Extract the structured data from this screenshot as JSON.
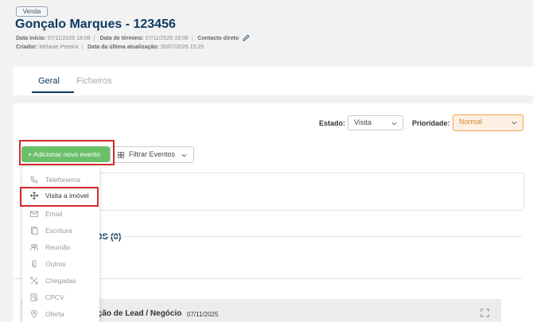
{
  "header": {
    "tag": "Venda",
    "title": "Gonçalo Marques - 123456",
    "meta_line1": [
      {
        "label": "Data início:",
        "value": "07/11/2025 18:06"
      },
      {
        "label": "Data de término:",
        "value": "07/11/2025 19:06"
      },
      {
        "label": "Contacto direto",
        "value": ""
      }
    ],
    "meta_line2": [
      {
        "label": "Criador:",
        "value": "Melanie Pereira"
      },
      {
        "label": "Data da última atualização:",
        "value": "30/07/2026 15:25"
      }
    ]
  },
  "tabs": [
    "Geral",
    "Ficheiros"
  ],
  "filters": {
    "estado_label": "Estado:",
    "estado_value": "Visita",
    "prioridade_label": "Prioridade:",
    "prioridade_value": "Normal"
  },
  "actions": {
    "add_event": "+ Adicionar novo evento",
    "filter_events": "Filtrar Eventos"
  },
  "event_menu": [
    {
      "label": "Telefonema",
      "icon": "phone-icon"
    },
    {
      "label": "Visita a imóvel",
      "icon": "move-icon"
    },
    {
      "label": "Email",
      "icon": "mail-icon"
    },
    {
      "label": "Escritura",
      "icon": "document-icon"
    },
    {
      "label": "Reunião",
      "icon": "people-icon"
    },
    {
      "label": "Outros",
      "icon": "paperclip-icon"
    },
    {
      "label": "Chegadas",
      "icon": "arrows-icon"
    },
    {
      "label": "CPCV",
      "icon": "contract-icon"
    },
    {
      "label": "Oferta",
      "icon": "pin-icon"
    }
  ],
  "section": {
    "partial_title": "OS (0)"
  },
  "timeline": {
    "partial_title": "ição de Lead / Negócio",
    "date": "07/11/2025"
  },
  "colors": {
    "title": "#0e3a63",
    "add_button": "#6abf69",
    "highlight": "#d22a2a",
    "priority": "#f0a24a"
  }
}
